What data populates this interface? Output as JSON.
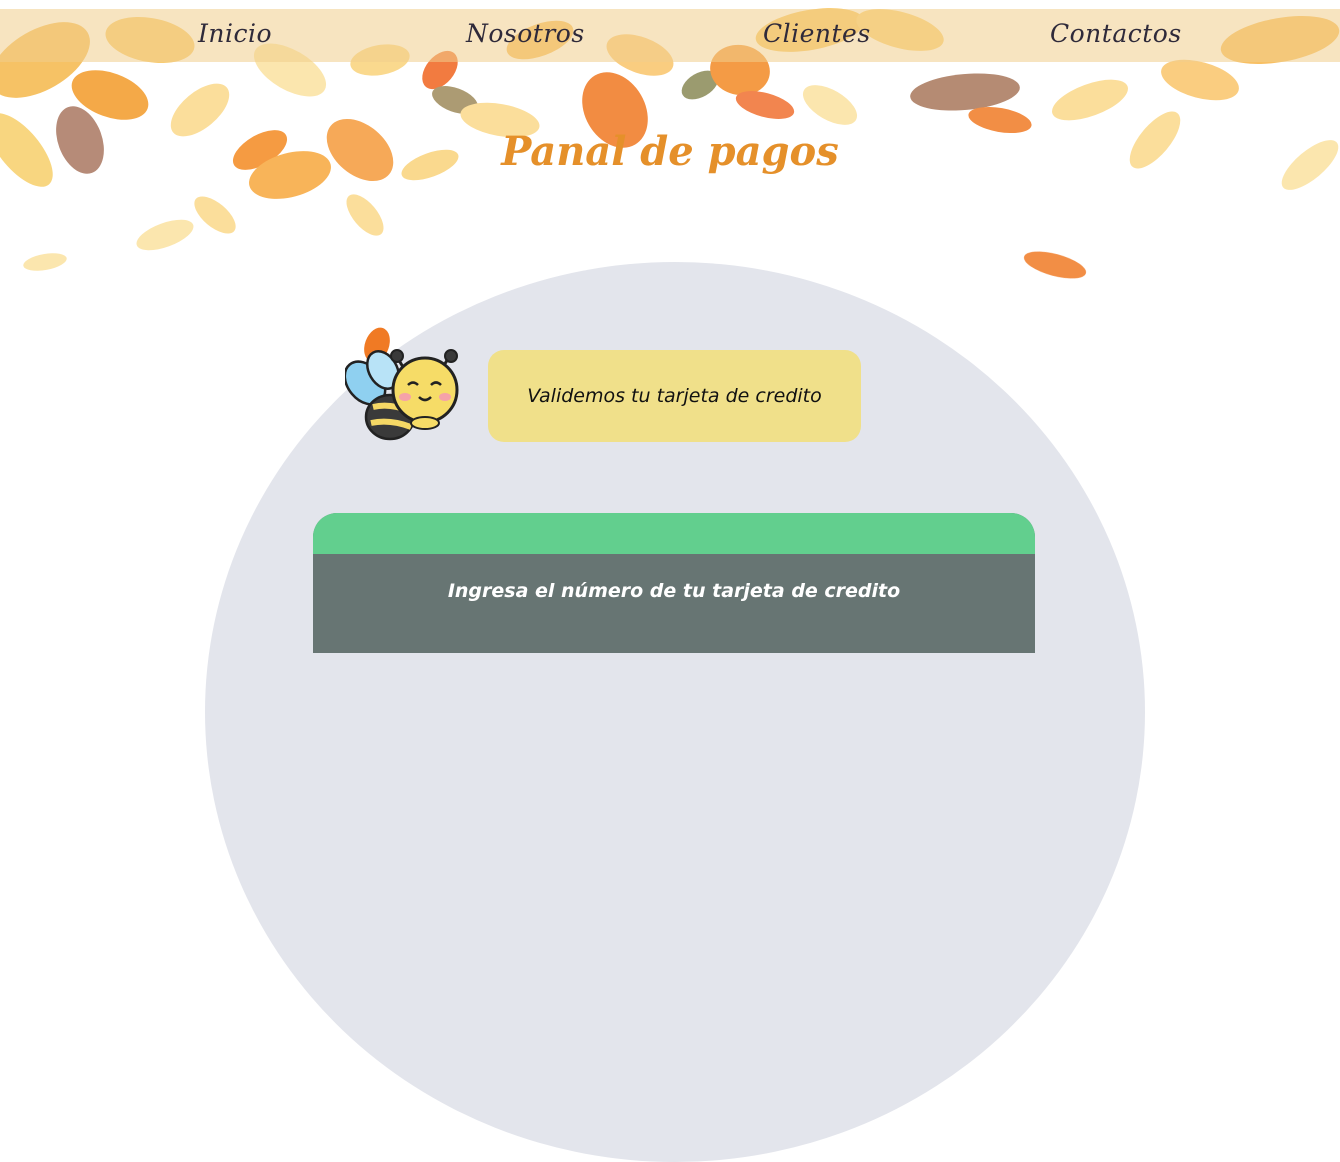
{
  "nav": {
    "items": [
      {
        "label": "Inicio"
      },
      {
        "label": "Nosotros"
      },
      {
        "label": "Clientes"
      },
      {
        "label": "Contactos"
      }
    ]
  },
  "page": {
    "title": "Panal de pagos"
  },
  "mascot": {
    "icon": "bee-icon",
    "message": "Validemos tu tarjeta de credito"
  },
  "card_panel": {
    "label": "Ingresa el número de tu tarjeta de credito"
  },
  "colors": {
    "title": "#e5902a",
    "nav_bar": "#f0cd8c",
    "speech_bubble": "#f0e08a",
    "card_header": "#62cf8e",
    "card_body": "#677573",
    "dome": "#e3e5ec"
  }
}
